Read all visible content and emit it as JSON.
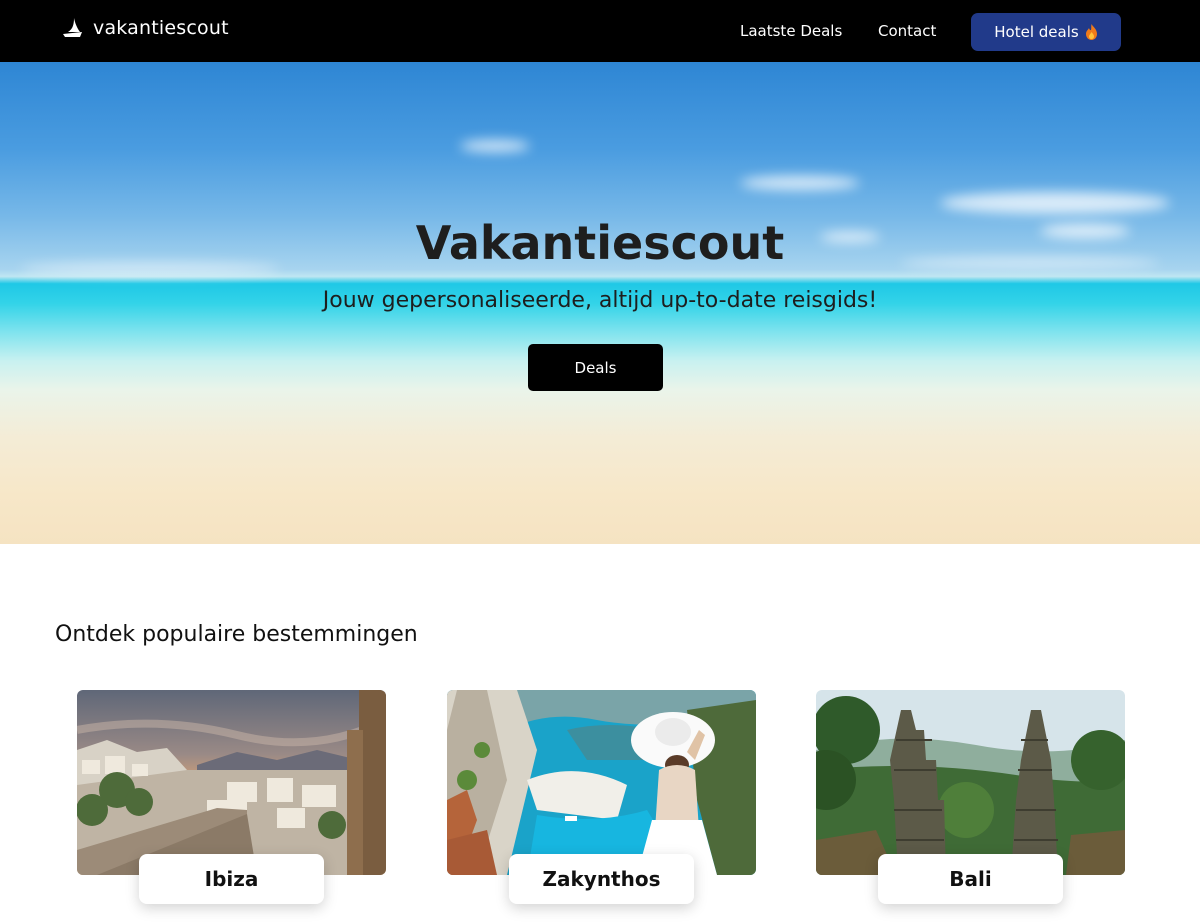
{
  "navbar": {
    "logo_text": "vakantiescout",
    "links": [
      "Laatste Deals",
      "Contact"
    ],
    "hotel_button": {
      "label": "Hotel deals",
      "icon": "fire-icon"
    },
    "logo_icon": "sail-icon"
  },
  "hero": {
    "title": "Vakantiescout",
    "subtitle": "Jouw gepersonaliseerde, altijd up-to-date reisgids!",
    "button_label": "Deals"
  },
  "destinations": {
    "title": "Ontdek populaire bestemmingen",
    "items": [
      {
        "name": "Ibiza"
      },
      {
        "name": "Zakynthos"
      },
      {
        "name": "Bali"
      }
    ]
  },
  "colors": {
    "navbar_bg": "#000000",
    "hotel_button_bg": "#213a8a",
    "hero_button_bg": "#000000"
  }
}
